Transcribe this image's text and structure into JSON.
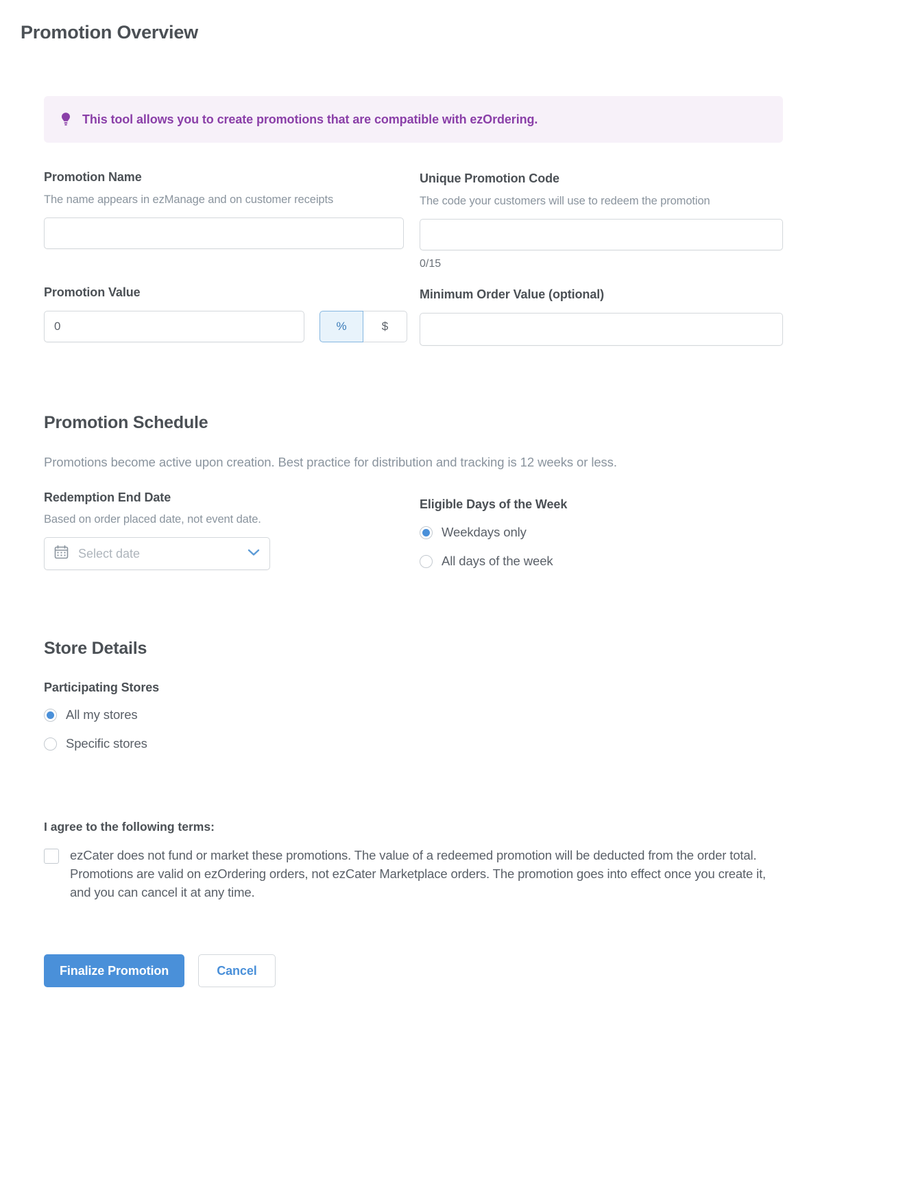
{
  "page": {
    "title": "Promotion Overview"
  },
  "banner": {
    "icon": "lightbulb-icon",
    "text": "This tool allows you to create promotions that are compatible with ezOrdering.",
    "accent_color": "#8a3fa8",
    "background_color": "#f7f1f9"
  },
  "overview": {
    "promotion_name": {
      "label": "Promotion Name",
      "help": "The name appears in ezManage and on customer receipts",
      "value": "",
      "placeholder": ""
    },
    "promotion_code": {
      "label": "Unique Promotion Code",
      "help": "The code your customers will use to redeem the promotion",
      "value": "",
      "placeholder": "",
      "counter": "0/15"
    },
    "promotion_value": {
      "label": "Promotion Value",
      "value": "0",
      "units": [
        {
          "label": "%",
          "selected": true
        },
        {
          "label": "$",
          "selected": false
        }
      ]
    },
    "minimum_order_value": {
      "label": "Minimum Order Value (optional)",
      "value": "",
      "placeholder": ""
    }
  },
  "schedule": {
    "title": "Promotion Schedule",
    "description": "Promotions become active upon creation. Best practice for distribution and tracking is 12 weeks or less.",
    "end_date": {
      "label": "Redemption End Date",
      "help": "Based on order placed date, not event date.",
      "placeholder": "Select date",
      "calendar_icon": "calendar-icon",
      "chevron_icon": "chevron-down-icon"
    },
    "eligible_days": {
      "label": "Eligible Days of the Week",
      "options": [
        {
          "label": "Weekdays only",
          "selected": true
        },
        {
          "label": "All days of the week",
          "selected": false
        }
      ]
    }
  },
  "store_details": {
    "title": "Store Details",
    "participating_stores": {
      "label": "Participating Stores",
      "options": [
        {
          "label": "All my stores",
          "selected": true
        },
        {
          "label": "Specific stores",
          "selected": false
        }
      ]
    }
  },
  "terms": {
    "title": "I agree to the following terms:",
    "checked": false,
    "text": "ezCater does not fund or market these promotions. The value of a redeemed promotion will be deducted from the order total. Promotions are valid on ezOrdering orders, not ezCater Marketplace orders. The promotion goes into effect once you create it, and you can cancel it at any time."
  },
  "actions": {
    "primary_label": "Finalize Promotion",
    "secondary_label": "Cancel",
    "primary_color": "#4a90d9"
  }
}
